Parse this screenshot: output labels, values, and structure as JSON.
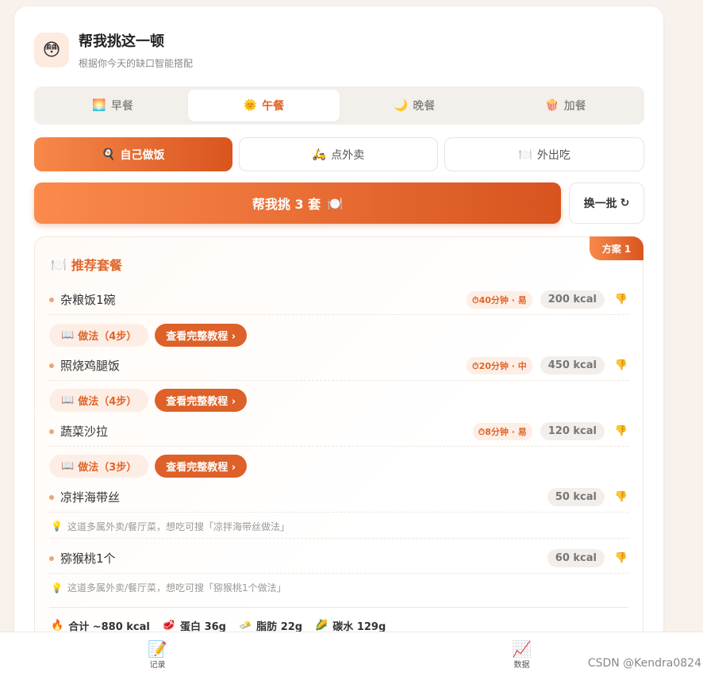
{
  "header": {
    "emoji": "😳",
    "title": "帮我挑这一顿",
    "subtitle": "根据你今天的缺口智能搭配"
  },
  "meal_tabs": [
    {
      "icon": "🌅",
      "label": "早餐",
      "active": false
    },
    {
      "icon": "🌞",
      "label": "午餐",
      "active": true
    },
    {
      "icon": "🌙",
      "label": "晚餐",
      "active": false
    },
    {
      "icon": "🍿",
      "label": "加餐",
      "active": false
    }
  ],
  "modes": [
    {
      "icon": "🍳",
      "label": "自己做饭",
      "active": true
    },
    {
      "icon": "🛵",
      "label": "点外卖",
      "active": false
    },
    {
      "icon": "🍽️",
      "label": "外出吃",
      "active": false
    }
  ],
  "actions": {
    "pick_label": "帮我挑 3 套",
    "pick_icon": "🍽️",
    "refresh_label": "换一批",
    "refresh_icon": "↻"
  },
  "plan": {
    "badge": "方案 1",
    "title_icon": "🍽️",
    "title": "推荐套餐",
    "dishes": [
      {
        "name": "杂粮饭1碗",
        "time": "⏱40分钟 · 易",
        "kcal": "200 kcal",
        "recipe": "做法（4步）",
        "tutorial": "查看完整教程 ›"
      },
      {
        "name": "照烧鸡腿饭",
        "time": "⏱20分钟 · 中",
        "kcal": "450 kcal",
        "recipe": "做法（4步）",
        "tutorial": "查看完整教程 ›"
      },
      {
        "name": "蔬菜沙拉",
        "time": "⏱8分钟 · 易",
        "kcal": "120 kcal",
        "recipe": "做法（3步）",
        "tutorial": "查看完整教程 ›"
      },
      {
        "name": "凉拌海带丝",
        "kcal": "50 kcal",
        "hint": "这道多属外卖/餐厅菜，想吃可搜「凉拌海带丝做法」"
      },
      {
        "name": "猕猴桃1个",
        "kcal": "60 kcal",
        "hint": "这道多属外卖/餐厅菜，想吃可搜「猕猴桃1个做法」"
      }
    ],
    "recipe_icon": "📖",
    "hint_icon": "💡",
    "thumb_icon": "👎",
    "summary": {
      "total": "合计 ~880 kcal",
      "protein": "蛋白 36g",
      "fat": "脂肪 22g",
      "carbs": "碳水 129g"
    }
  },
  "bottom_nav": [
    {
      "icon": "📝",
      "label": "记录"
    },
    {
      "icon": "📈",
      "label": "数据"
    }
  ],
  "watermark": "CSDN @Kendra0824"
}
